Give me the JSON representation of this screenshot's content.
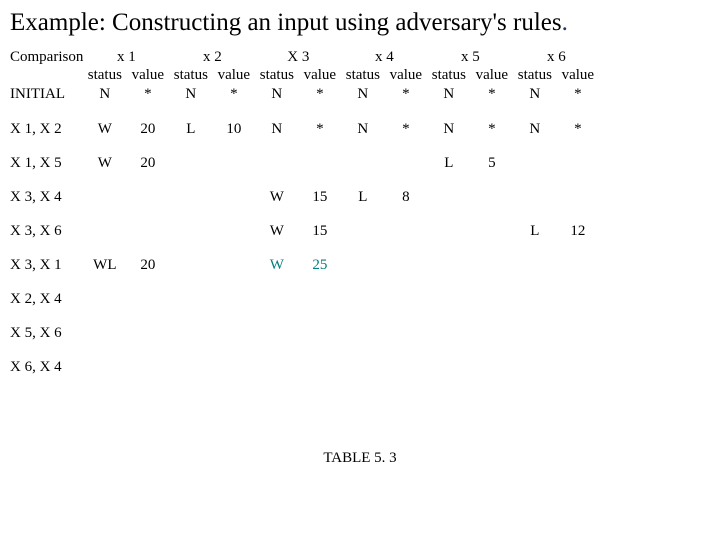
{
  "title_main": "Example: Constructing an input using adversary's rules",
  "title_tail": ".",
  "header": {
    "comparison": "Comparison",
    "status": "status",
    "value": "value",
    "cols": [
      "x 1",
      "x 2",
      "X 3",
      "x 4",
      "x 5",
      "x 6"
    ],
    "initial_label": "INITIAL",
    "initial": {
      "status": "N",
      "value": "*"
    }
  },
  "rows": [
    {
      "label": "X 1, X 2",
      "cells": [
        "W",
        "20",
        "L",
        "10",
        "N",
        "*",
        "N",
        "*",
        "N",
        "*",
        "N",
        "*"
      ]
    },
    {
      "label": "X 1, X 5",
      "cells": [
        "W",
        "20",
        "",
        "",
        "",
        "",
        "",
        "",
        "L",
        "5",
        "",
        ""
      ]
    },
    {
      "label": "X 3, X 4",
      "cells": [
        "",
        "",
        "",
        "",
        "W",
        "15",
        "L",
        "8",
        "",
        "",
        "",
        ""
      ]
    },
    {
      "label": "X 3, X 6",
      "cells": [
        "",
        "",
        "",
        "",
        "W",
        "15",
        "",
        "",
        "",
        "",
        "L",
        "12"
      ]
    },
    {
      "label": "X 3, X 1",
      "cells": [
        "WL",
        "20",
        "",
        "",
        "W",
        "25",
        "",
        "",
        "",
        "",
        "",
        ""
      ],
      "teal": [
        4,
        5
      ]
    },
    {
      "label": "X 2, X 4",
      "cells": [
        "",
        "",
        "",
        "",
        "",
        "",
        "",
        "",
        "",
        "",
        "",
        ""
      ]
    },
    {
      "label": "X 5, X 6",
      "cells": [
        "",
        "",
        "",
        "",
        "",
        "",
        "",
        "",
        "",
        "",
        "",
        ""
      ]
    },
    {
      "label": "X 6, X 4",
      "cells": [
        "",
        "",
        "",
        "",
        "",
        "",
        "",
        "",
        "",
        "",
        "",
        ""
      ]
    }
  ],
  "caption": "TABLE 5. 3",
  "chart_data": {
    "type": "table",
    "title": "Constructing an input using adversary's rules",
    "columns": [
      "Comparison",
      "x1 status",
      "x1 value",
      "x2 status",
      "x2 value",
      "X3 status",
      "X3 value",
      "x4 status",
      "x4 value",
      "x5 status",
      "x5 value",
      "x6 status",
      "x6 value"
    ],
    "rows": [
      [
        "INITIAL",
        "N",
        "*",
        "N",
        "*",
        "N",
        "*",
        "N",
        "*",
        "N",
        "*",
        "N",
        "*"
      ],
      [
        "X1,X2",
        "W",
        "20",
        "L",
        "10",
        "N",
        "*",
        "N",
        "*",
        "N",
        "*",
        "N",
        "*"
      ],
      [
        "X1,X5",
        "W",
        "20",
        "",
        "",
        "",
        "",
        "",
        "",
        "L",
        "5",
        "",
        ""
      ],
      [
        "X3,X4",
        "",
        "",
        "",
        "",
        "W",
        "15",
        "L",
        "8",
        "",
        "",
        "",
        ""
      ],
      [
        "X3,X6",
        "",
        "",
        "",
        "",
        "W",
        "15",
        "",
        "",
        "",
        "",
        "L",
        "12"
      ],
      [
        "X3,X1",
        "WL",
        "20",
        "",
        "",
        "W",
        "25",
        "",
        "",
        "",
        "",
        "",
        ""
      ],
      [
        "X2,X4",
        "",
        "",
        "",
        "",
        "",
        "",
        "",
        "",
        "",
        "",
        "",
        ""
      ],
      [
        "X5,X6",
        "",
        "",
        "",
        "",
        "",
        "",
        "",
        "",
        "",
        "",
        "",
        ""
      ],
      [
        "X6,X4",
        "",
        "",
        "",
        "",
        "",
        "",
        "",
        "",
        "",
        "",
        "",
        ""
      ]
    ]
  }
}
